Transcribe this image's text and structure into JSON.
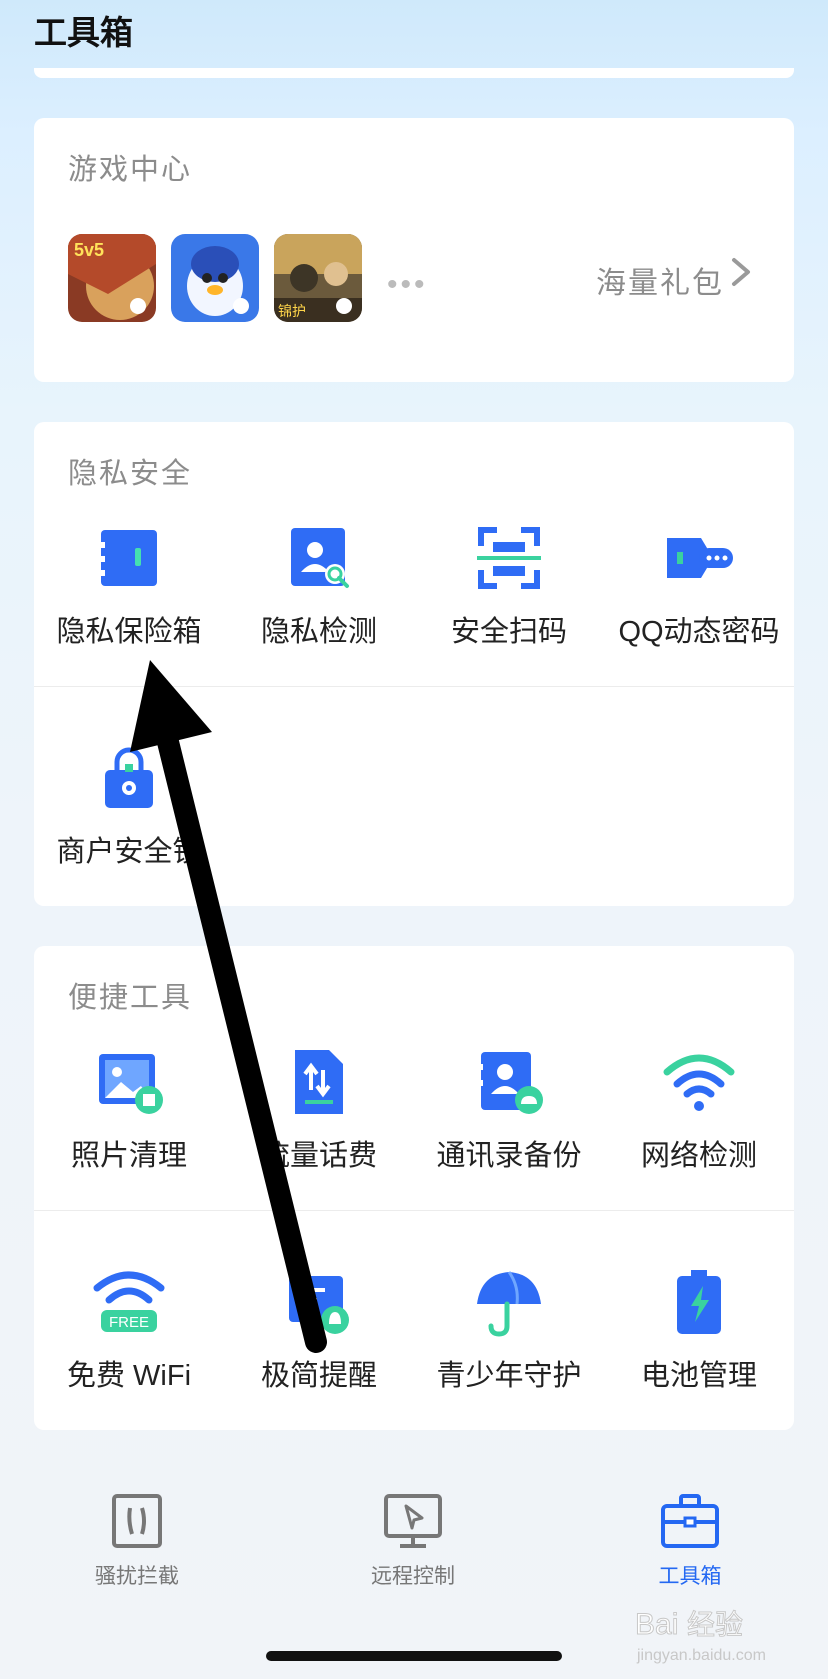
{
  "header": {
    "title": "工具箱"
  },
  "game_center": {
    "title": "游戏中心",
    "more": "•••",
    "gift_link": "海量礼包"
  },
  "privacy": {
    "title": "隐私安全",
    "items": [
      {
        "label": "隐私保险箱",
        "icon": "safe-box-icon"
      },
      {
        "label": "隐私检测",
        "icon": "privacy-scan-icon"
      },
      {
        "label": "安全扫码",
        "icon": "qr-scan-icon"
      },
      {
        "label": "QQ动态密码",
        "icon": "dynamic-key-icon"
      },
      {
        "label": "商户安全锁",
        "icon": "merchant-lock-icon"
      }
    ]
  },
  "quick_tools": {
    "title": "便捷工具",
    "items": [
      {
        "label": "照片清理",
        "icon": "photo-clean-icon"
      },
      {
        "label": "流量话费",
        "icon": "data-bill-icon"
      },
      {
        "label": "通讯录备份",
        "icon": "contacts-backup-icon"
      },
      {
        "label": "网络检测",
        "icon": "wifi-check-icon"
      },
      {
        "label": "免费 WiFi",
        "icon": "free-wifi-icon",
        "badge": "FREE"
      },
      {
        "label": "极简提醒",
        "icon": "reminder-icon"
      },
      {
        "label": "青少年守护",
        "icon": "umbrella-icon"
      },
      {
        "label": "电池管理",
        "icon": "battery-icon"
      }
    ]
  },
  "tabbar": {
    "items": [
      {
        "label": "骚扰拦截",
        "icon": "call-block-icon",
        "active": false
      },
      {
        "label": "远程控制",
        "icon": "remote-control-icon",
        "active": false
      },
      {
        "label": "工具箱",
        "icon": "toolbox-icon",
        "active": true
      }
    ]
  },
  "watermark": {
    "brand": "Bai经验",
    "url": "jingyan.baidu.com"
  },
  "colors": {
    "accent": "#2468f2",
    "green": "#3ad29f",
    "card": "#ffffff"
  }
}
